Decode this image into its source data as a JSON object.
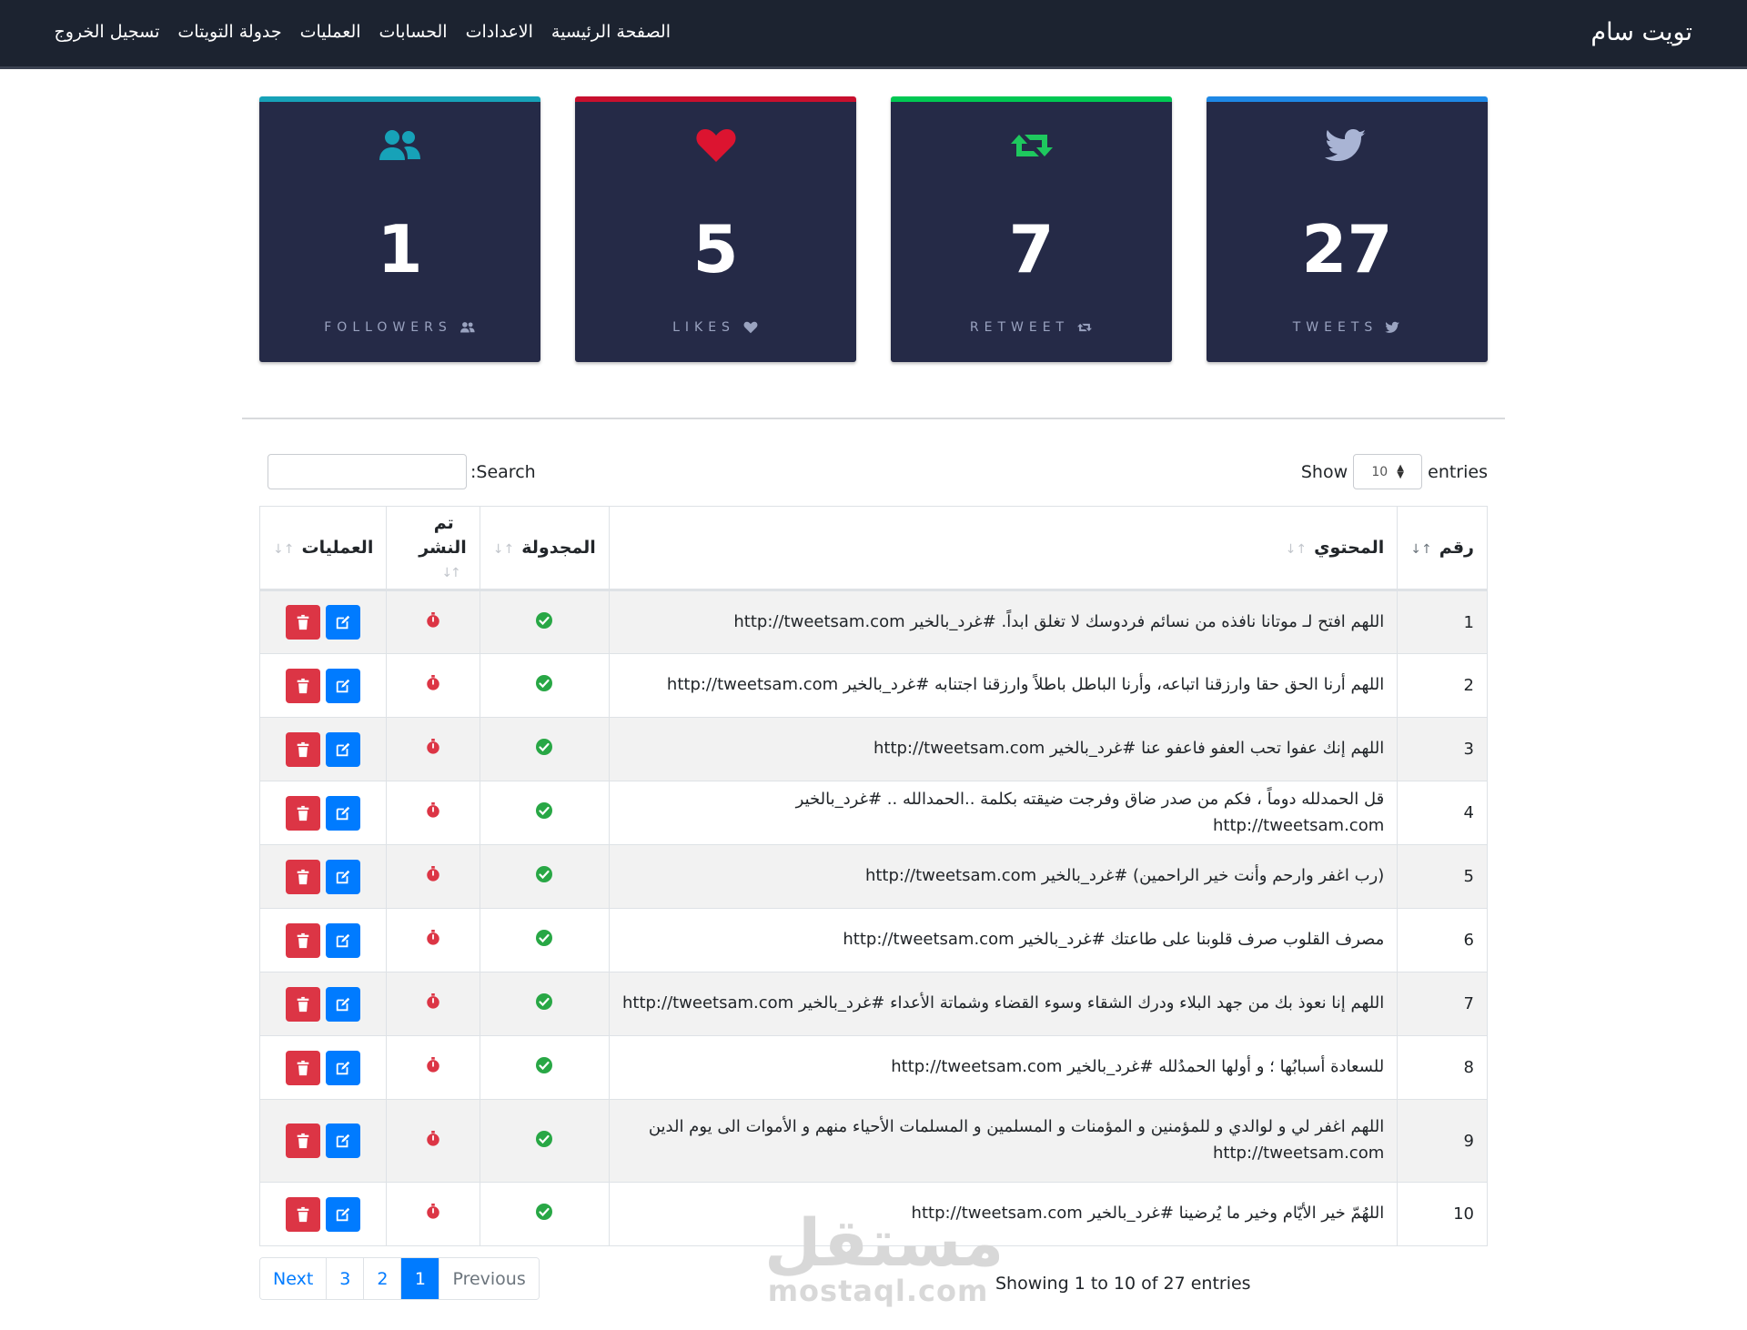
{
  "nav": {
    "brand": "تويت سام",
    "links": [
      "الصفحة الرئيسية",
      "الاعدادات",
      "الحسابات",
      "العمليات",
      "جدولة التويتات",
      "تسجيل الخروج"
    ]
  },
  "stats": [
    {
      "value": "1",
      "label": "FOLLOWERS",
      "icon": "users-icon",
      "color": "#17a2b8"
    },
    {
      "value": "5",
      "label": "LIKES",
      "icon": "heart-icon",
      "color": "#dc3545"
    },
    {
      "value": "7",
      "label": "RETWEET",
      "icon": "retweet-icon",
      "color": "#28a745"
    },
    {
      "value": "27",
      "label": "TWEETS",
      "icon": "twitter-icon",
      "color": "#1da1f2"
    }
  ],
  "controls": {
    "search_label": ":Search",
    "show_label": "Show",
    "entries_label": "entries",
    "page_length": "10"
  },
  "table": {
    "headers": {
      "num": "رقم",
      "content": "المحتوي",
      "scheduled": "المجدولة",
      "published": "تم النشر",
      "operations": "العمليات"
    },
    "rows": [
      {
        "num": "1",
        "content": "اللهم افتح لـ موتانا نافذه من نسائم فردوسك لا تغلق ابداً. #غرد_بالخير http://tweetsam.com"
      },
      {
        "num": "2",
        "content": "اللهم أرنا الحق حقا وارزقنا اتباعه، وأرنا الباطل باطلاً وارزقنا اجتنابه #غرد_بالخير http://tweetsam.com"
      },
      {
        "num": "3",
        "content": "اللهم إنك عفوا تحب العفو فاعفو عنا #غرد_بالخير http://tweetsam.com"
      },
      {
        "num": "4",
        "content": "قل الحمدلله دوماً ، فكم من صدر ضاق وفرجت ضيقته بكلمة ..الحمدالله .. #غرد_بالخير http://tweetsam.com"
      },
      {
        "num": "5",
        "content": "(رب اغفر وارحم وأنت خير الراحمين) #غرد_بالخير http://tweetsam.com"
      },
      {
        "num": "6",
        "content": "مصرف القلوب صرف قلوبنا على طاعتك #غرد_بالخير http://tweetsam.com"
      },
      {
        "num": "7",
        "content": "اللهم إنا نعوذ بك من جهد البلاء ودرك الشقاء وسوء القضاء وشماتة الأعداء #غرد_بالخير http://tweetsam.com"
      },
      {
        "num": "8",
        "content": "للسعادة أسبابُها ؛ و أولها الحمدُلله #غرد_بالخير http://tweetsam.com"
      },
      {
        "num": "9",
        "content": "اللهم اغفر لي و لوالدي و للمؤمنين و المؤمنات و المسلمين و المسلمات الأحياء منهم و الأموات الى يوم الدين http://tweetsam.com"
      },
      {
        "num": "10",
        "content": "اللهُمّ خير الأيّام وخير ما يُرضينا #غرد_بالخير http://tweetsam.com"
      }
    ]
  },
  "pagination": {
    "previous": "Previous",
    "pages": [
      "1",
      "2",
      "3"
    ],
    "next": "Next",
    "info": "Showing 1 to 10 of 27 entries"
  },
  "watermark": {
    "arabic": "مستقل",
    "latin": "mostaql.com"
  },
  "colors": {
    "navbar": "#1c2330",
    "card": "#252a47",
    "check": "#28a745",
    "pending": "#dc3545"
  }
}
